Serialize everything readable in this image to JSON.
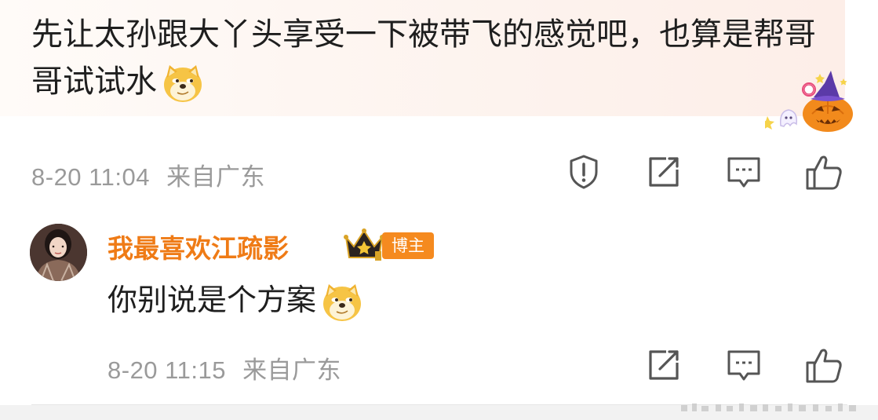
{
  "comment": {
    "text": "先让太孙跟大丫头享受一下被带飞的感觉吧，也算是帮哥哥试试水",
    "emoji": "doge-emoji",
    "timestamp": "8-20 11:04",
    "location": "来自广东",
    "actions": [
      "report-icon",
      "share-icon",
      "reply-icon",
      "like-icon"
    ]
  },
  "reply": {
    "username": "我最喜欢江疏影",
    "badge": "博主",
    "text": "你别说是个方案",
    "emoji": "doge-emoji",
    "timestamp": "8-20 11:15",
    "location": "来自广东",
    "actions": [
      "share-icon",
      "reply-icon",
      "like-icon"
    ]
  },
  "colors": {
    "username": "#ef7b16",
    "badge_bg": "#f58a1f",
    "meta_text": "#9a9a9a",
    "body_text": "#1e1e1e"
  }
}
